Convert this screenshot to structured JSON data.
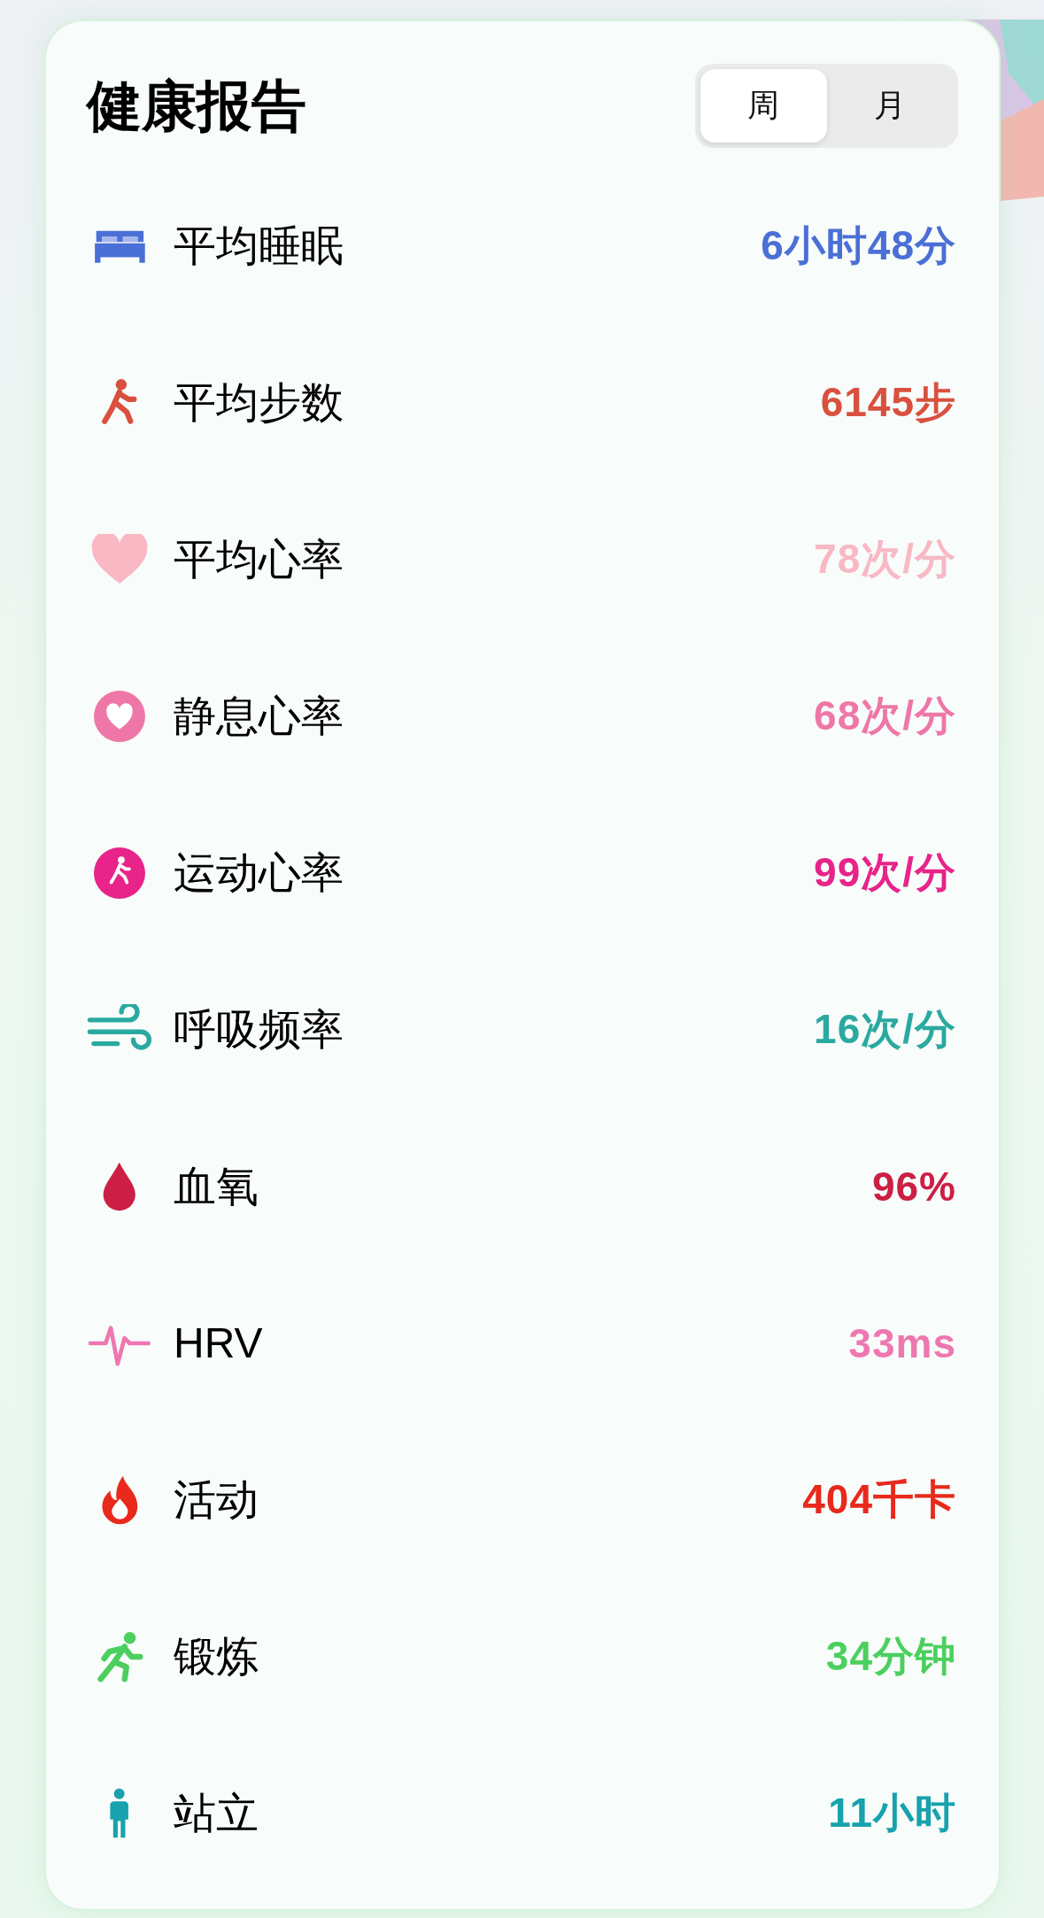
{
  "title": "健康报告",
  "tabs": [
    {
      "label": "周",
      "selected": true
    },
    {
      "label": "月",
      "selected": false
    }
  ],
  "metrics": [
    {
      "kind": "bed",
      "label": "平均睡眠",
      "value": "6小时48分",
      "color": "#4a6fd6"
    },
    {
      "kind": "walk",
      "label": "平均步数",
      "value": "6145步",
      "color": "#d9503f"
    },
    {
      "kind": "heart",
      "label": "平均心率",
      "value": "78次/分",
      "color": "#f8b8c4"
    },
    {
      "kind": "heart-circle",
      "label": "静息心率",
      "value": "68次/分",
      "color": "#ee77a8"
    },
    {
      "kind": "walk-circle",
      "label": "运动心率",
      "value": "99次/分",
      "color": "#e8238a"
    },
    {
      "kind": "wind",
      "label": "呼吸频率",
      "value": "16次/分",
      "color": "#2aa9a0"
    },
    {
      "kind": "drop",
      "label": "血氧",
      "value": "96%",
      "color": "#cc1f45"
    },
    {
      "kind": "pulse",
      "label": "HRV",
      "value": "33ms",
      "color": "#ee77b0"
    },
    {
      "kind": "flame",
      "label": "活动",
      "value": "404千卡",
      "color": "#e8291c"
    },
    {
      "kind": "run",
      "label": "锻炼",
      "value": "34分钟",
      "color": "#4ccf5f"
    },
    {
      "kind": "stand",
      "label": "站立",
      "value": "11小时",
      "color": "#17a2ad"
    }
  ]
}
